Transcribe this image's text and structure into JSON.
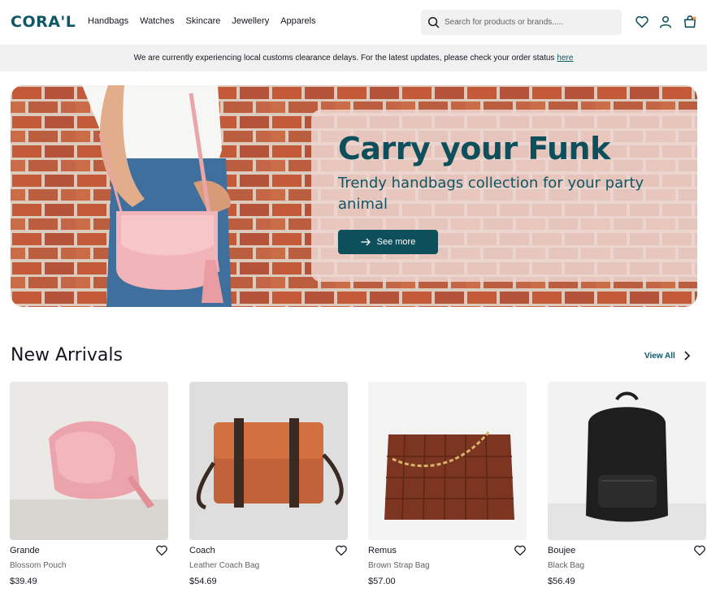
{
  "header": {
    "logo": "CORA'L",
    "nav": [
      "Handbags",
      "Watches",
      "Skincare",
      "Jewellery",
      "Apparels"
    ],
    "search_placeholder": "Search for products or brands.....",
    "icons": [
      "search-icon",
      "heart-icon",
      "user-icon",
      "cart-icon"
    ]
  },
  "notice": {
    "text": "We are currently experiencing local customs clearance delays. For the latest updates, please check your order status",
    "link": "here"
  },
  "hero": {
    "title": "Carry your Funk",
    "subtitle": "Trendy handbags collection for your party animal",
    "button": "See more"
  },
  "arrivals": {
    "title": "New Arrivals",
    "view_all": "View All",
    "products": [
      {
        "name": "Grande",
        "desc": "Blossom Pouch",
        "price": "$39.49"
      },
      {
        "name": "Coach",
        "desc": "Leather Coach Bag",
        "price": "$54.69"
      },
      {
        "name": "Remus",
        "desc": "Brown Strap Bag",
        "price": "$57.00"
      },
      {
        "name": "Boujee",
        "desc": "Black Bag",
        "price": "$56.49"
      }
    ]
  },
  "colors": {
    "brand": "#0e5766",
    "accent": "#ff8c4b"
  }
}
